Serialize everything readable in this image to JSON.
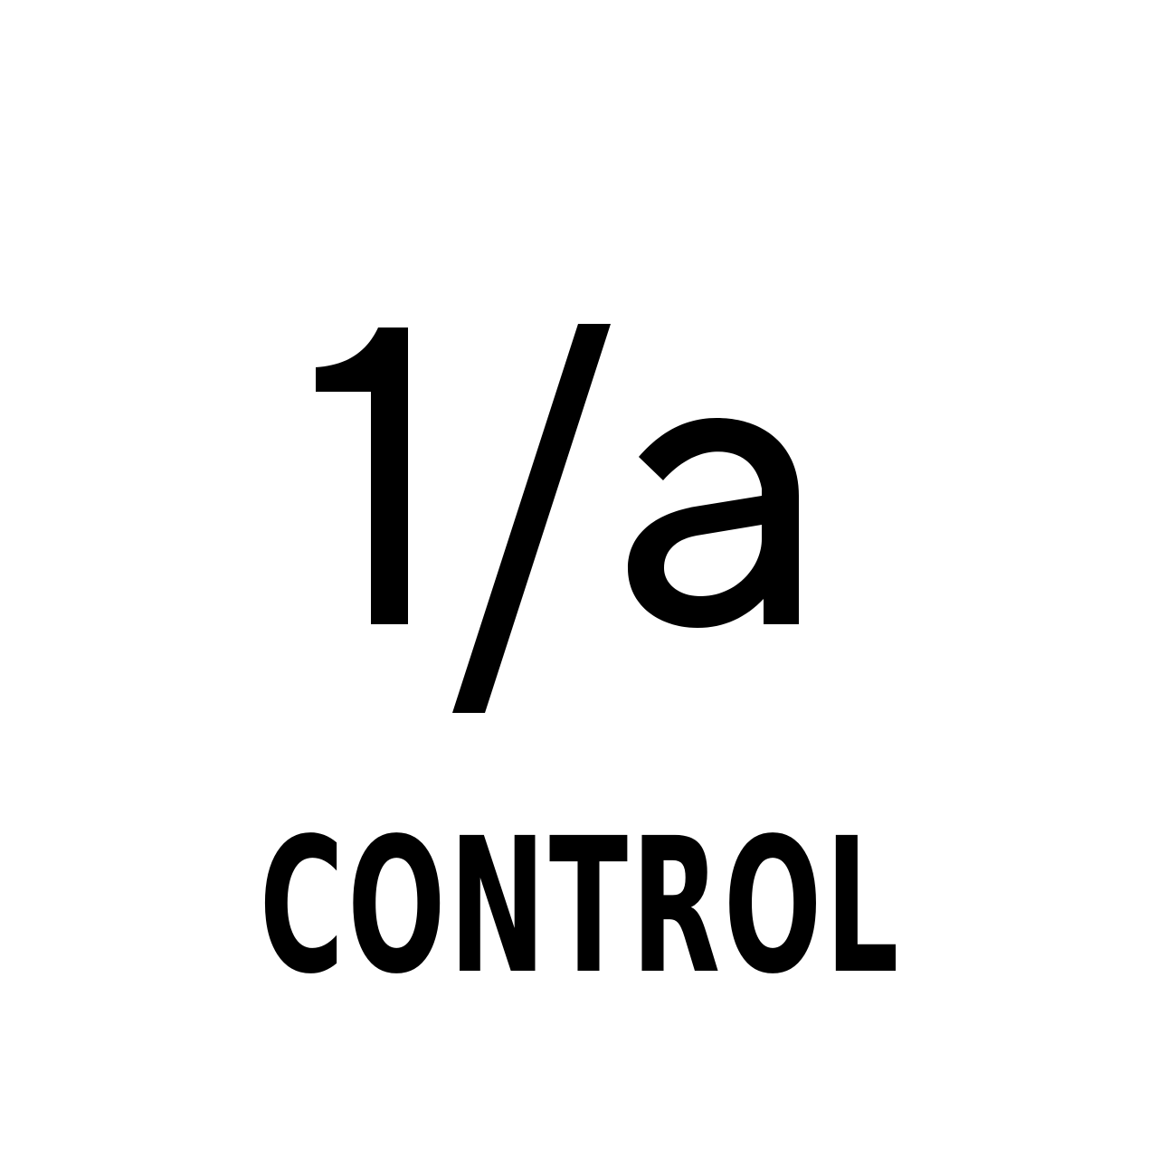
{
  "glyph": {
    "symbol_text": "1/a",
    "icon": "one-over-a-symbol",
    "color": "#000000"
  },
  "caption": {
    "text": "CONTROL"
  },
  "background_color": "#ffffff"
}
